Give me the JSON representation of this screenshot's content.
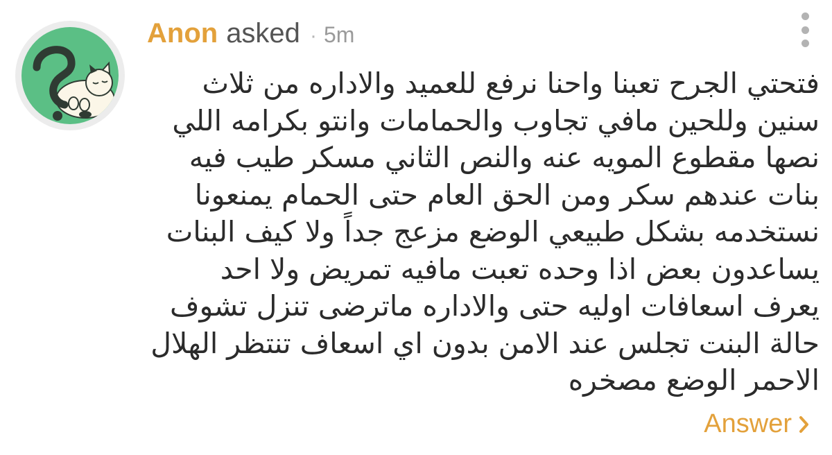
{
  "question": {
    "asker": "Anon",
    "action": "asked",
    "separator": "·",
    "time": "5m",
    "text_lines": [
      "فتحتي الجرح تعبنا واحنا نرفع للعميد والاداره من ثلاث",
      "سنين وللحين مافي تجاوب والحمامات وانتو بكرامه اللي",
      "نصها مقطوع المويه عنه والنص الثاني مسكر طيب فيه",
      "بنات عندهم سكر ومن الحق العام حتى الحمام يمنعونا",
      "نستخدمه بشكل طبيعي الوضع مزعج جداً ولا كيف البنات",
      "يساعدون بعض اذا وحده تعبت مافيه تمريض ولا احد",
      "يعرف اسعافات اوليه حتى والاداره ماترضى تنزل تشوف",
      "حالة البنت تجلس عند الامن بدون اي اسعاف تنتظر الهلال",
      "الاحمر الوضع مصخره"
    ]
  },
  "actions": {
    "answer_label": "Answer"
  },
  "icons": {
    "avatar": "question-mark-cat-icon",
    "menu": "more-vertical-icon",
    "answer_chevron": "chevron-right-icon"
  },
  "colors": {
    "accent": "#e3a13b",
    "avatar_background": "#5bbf85",
    "text": "#2b2b2b"
  }
}
